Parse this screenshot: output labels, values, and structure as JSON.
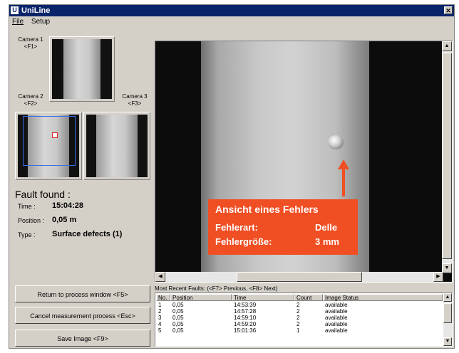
{
  "window": {
    "title": "UniLine",
    "close": "✕"
  },
  "menu": [
    {
      "label": "File"
    },
    {
      "label": "Setup"
    }
  ],
  "cameras": {
    "camera1": {
      "name": "Camera 1",
      "key": "<F1>"
    },
    "camera2": {
      "name": "Camera 2",
      "key": "<F2>"
    },
    "camera3": {
      "name": "Camera 3",
      "key": "<F3>"
    }
  },
  "fault": {
    "title": "Fault found :",
    "time_label": "Time :",
    "time_value": "15:04:28",
    "position_label": "Position :",
    "position_value": "0,05 m",
    "type_label": "Type :",
    "type_value": "Surface defects (1)"
  },
  "overlay": {
    "title": "Ansicht eines Fehlers",
    "row1_label": "Fehlerart:",
    "row1_value": "Delle",
    "row2_label": "Fehlergröße:",
    "row2_value": "3 mm",
    "color": "#f04e23"
  },
  "buttons": {
    "return": "Return to process window <F5>",
    "cancel": "Cancel measurement process <Esc>",
    "save": "Save Image <F9>"
  },
  "faults_table": {
    "caption": "Most Recent Faults: (<F7> Previous, <F8> Next)",
    "columns": [
      "No.",
      "Position",
      "Time",
      "Count",
      "Image Status"
    ],
    "rows": [
      [
        "1",
        "0,05",
        "14:53:39",
        "2",
        "available"
      ],
      [
        "2",
        "0,05",
        "14:57:28",
        "2",
        "available"
      ],
      [
        "3",
        "0,05",
        "14:59:10",
        "2",
        "available"
      ],
      [
        "4",
        "0,05",
        "14:59:20",
        "2",
        "available"
      ],
      [
        "5",
        "0,05",
        "15:01:36",
        "1",
        "available"
      ]
    ]
  },
  "icons": {
    "up": "▲",
    "down": "▼",
    "left": "◀",
    "right": "▶"
  }
}
